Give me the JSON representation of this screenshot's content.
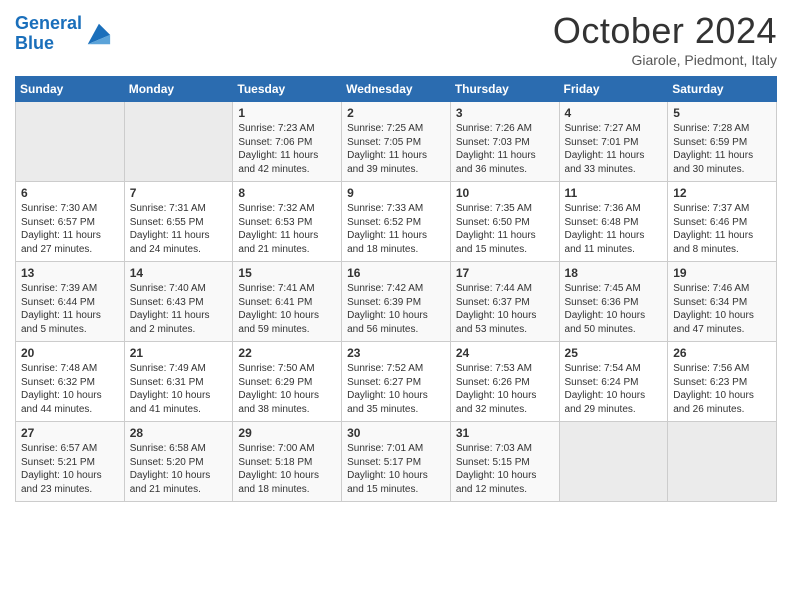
{
  "logo": {
    "line1": "General",
    "line2": "Blue"
  },
  "title": "October 2024",
  "subtitle": "Giarole, Piedmont, Italy",
  "days_header": [
    "Sunday",
    "Monday",
    "Tuesday",
    "Wednesday",
    "Thursday",
    "Friday",
    "Saturday"
  ],
  "weeks": [
    [
      {
        "day": "",
        "sunrise": "",
        "sunset": "",
        "daylight": "",
        "empty": true
      },
      {
        "day": "",
        "sunrise": "",
        "sunset": "",
        "daylight": "",
        "empty": true
      },
      {
        "day": "1",
        "sunrise": "Sunrise: 7:23 AM",
        "sunset": "Sunset: 7:06 PM",
        "daylight": "Daylight: 11 hours and 42 minutes."
      },
      {
        "day": "2",
        "sunrise": "Sunrise: 7:25 AM",
        "sunset": "Sunset: 7:05 PM",
        "daylight": "Daylight: 11 hours and 39 minutes."
      },
      {
        "day": "3",
        "sunrise": "Sunrise: 7:26 AM",
        "sunset": "Sunset: 7:03 PM",
        "daylight": "Daylight: 11 hours and 36 minutes."
      },
      {
        "day": "4",
        "sunrise": "Sunrise: 7:27 AM",
        "sunset": "Sunset: 7:01 PM",
        "daylight": "Daylight: 11 hours and 33 minutes."
      },
      {
        "day": "5",
        "sunrise": "Sunrise: 7:28 AM",
        "sunset": "Sunset: 6:59 PM",
        "daylight": "Daylight: 11 hours and 30 minutes."
      }
    ],
    [
      {
        "day": "6",
        "sunrise": "Sunrise: 7:30 AM",
        "sunset": "Sunset: 6:57 PM",
        "daylight": "Daylight: 11 hours and 27 minutes."
      },
      {
        "day": "7",
        "sunrise": "Sunrise: 7:31 AM",
        "sunset": "Sunset: 6:55 PM",
        "daylight": "Daylight: 11 hours and 24 minutes."
      },
      {
        "day": "8",
        "sunrise": "Sunrise: 7:32 AM",
        "sunset": "Sunset: 6:53 PM",
        "daylight": "Daylight: 11 hours and 21 minutes."
      },
      {
        "day": "9",
        "sunrise": "Sunrise: 7:33 AM",
        "sunset": "Sunset: 6:52 PM",
        "daylight": "Daylight: 11 hours and 18 minutes."
      },
      {
        "day": "10",
        "sunrise": "Sunrise: 7:35 AM",
        "sunset": "Sunset: 6:50 PM",
        "daylight": "Daylight: 11 hours and 15 minutes."
      },
      {
        "day": "11",
        "sunrise": "Sunrise: 7:36 AM",
        "sunset": "Sunset: 6:48 PM",
        "daylight": "Daylight: 11 hours and 11 minutes."
      },
      {
        "day": "12",
        "sunrise": "Sunrise: 7:37 AM",
        "sunset": "Sunset: 6:46 PM",
        "daylight": "Daylight: 11 hours and 8 minutes."
      }
    ],
    [
      {
        "day": "13",
        "sunrise": "Sunrise: 7:39 AM",
        "sunset": "Sunset: 6:44 PM",
        "daylight": "Daylight: 11 hours and 5 minutes."
      },
      {
        "day": "14",
        "sunrise": "Sunrise: 7:40 AM",
        "sunset": "Sunset: 6:43 PM",
        "daylight": "Daylight: 11 hours and 2 minutes."
      },
      {
        "day": "15",
        "sunrise": "Sunrise: 7:41 AM",
        "sunset": "Sunset: 6:41 PM",
        "daylight": "Daylight: 10 hours and 59 minutes."
      },
      {
        "day": "16",
        "sunrise": "Sunrise: 7:42 AM",
        "sunset": "Sunset: 6:39 PM",
        "daylight": "Daylight: 10 hours and 56 minutes."
      },
      {
        "day": "17",
        "sunrise": "Sunrise: 7:44 AM",
        "sunset": "Sunset: 6:37 PM",
        "daylight": "Daylight: 10 hours and 53 minutes."
      },
      {
        "day": "18",
        "sunrise": "Sunrise: 7:45 AM",
        "sunset": "Sunset: 6:36 PM",
        "daylight": "Daylight: 10 hours and 50 minutes."
      },
      {
        "day": "19",
        "sunrise": "Sunrise: 7:46 AM",
        "sunset": "Sunset: 6:34 PM",
        "daylight": "Daylight: 10 hours and 47 minutes."
      }
    ],
    [
      {
        "day": "20",
        "sunrise": "Sunrise: 7:48 AM",
        "sunset": "Sunset: 6:32 PM",
        "daylight": "Daylight: 10 hours and 44 minutes."
      },
      {
        "day": "21",
        "sunrise": "Sunrise: 7:49 AM",
        "sunset": "Sunset: 6:31 PM",
        "daylight": "Daylight: 10 hours and 41 minutes."
      },
      {
        "day": "22",
        "sunrise": "Sunrise: 7:50 AM",
        "sunset": "Sunset: 6:29 PM",
        "daylight": "Daylight: 10 hours and 38 minutes."
      },
      {
        "day": "23",
        "sunrise": "Sunrise: 7:52 AM",
        "sunset": "Sunset: 6:27 PM",
        "daylight": "Daylight: 10 hours and 35 minutes."
      },
      {
        "day": "24",
        "sunrise": "Sunrise: 7:53 AM",
        "sunset": "Sunset: 6:26 PM",
        "daylight": "Daylight: 10 hours and 32 minutes."
      },
      {
        "day": "25",
        "sunrise": "Sunrise: 7:54 AM",
        "sunset": "Sunset: 6:24 PM",
        "daylight": "Daylight: 10 hours and 29 minutes."
      },
      {
        "day": "26",
        "sunrise": "Sunrise: 7:56 AM",
        "sunset": "Sunset: 6:23 PM",
        "daylight": "Daylight: 10 hours and 26 minutes."
      }
    ],
    [
      {
        "day": "27",
        "sunrise": "Sunrise: 6:57 AM",
        "sunset": "Sunset: 5:21 PM",
        "daylight": "Daylight: 10 hours and 23 minutes."
      },
      {
        "day": "28",
        "sunrise": "Sunrise: 6:58 AM",
        "sunset": "Sunset: 5:20 PM",
        "daylight": "Daylight: 10 hours and 21 minutes."
      },
      {
        "day": "29",
        "sunrise": "Sunrise: 7:00 AM",
        "sunset": "Sunset: 5:18 PM",
        "daylight": "Daylight: 10 hours and 18 minutes."
      },
      {
        "day": "30",
        "sunrise": "Sunrise: 7:01 AM",
        "sunset": "Sunset: 5:17 PM",
        "daylight": "Daylight: 10 hours and 15 minutes."
      },
      {
        "day": "31",
        "sunrise": "Sunrise: 7:03 AM",
        "sunset": "Sunset: 5:15 PM",
        "daylight": "Daylight: 10 hours and 12 minutes."
      },
      {
        "day": "",
        "sunrise": "",
        "sunset": "",
        "daylight": "",
        "empty": true
      },
      {
        "day": "",
        "sunrise": "",
        "sunset": "",
        "daylight": "",
        "empty": true
      }
    ]
  ]
}
